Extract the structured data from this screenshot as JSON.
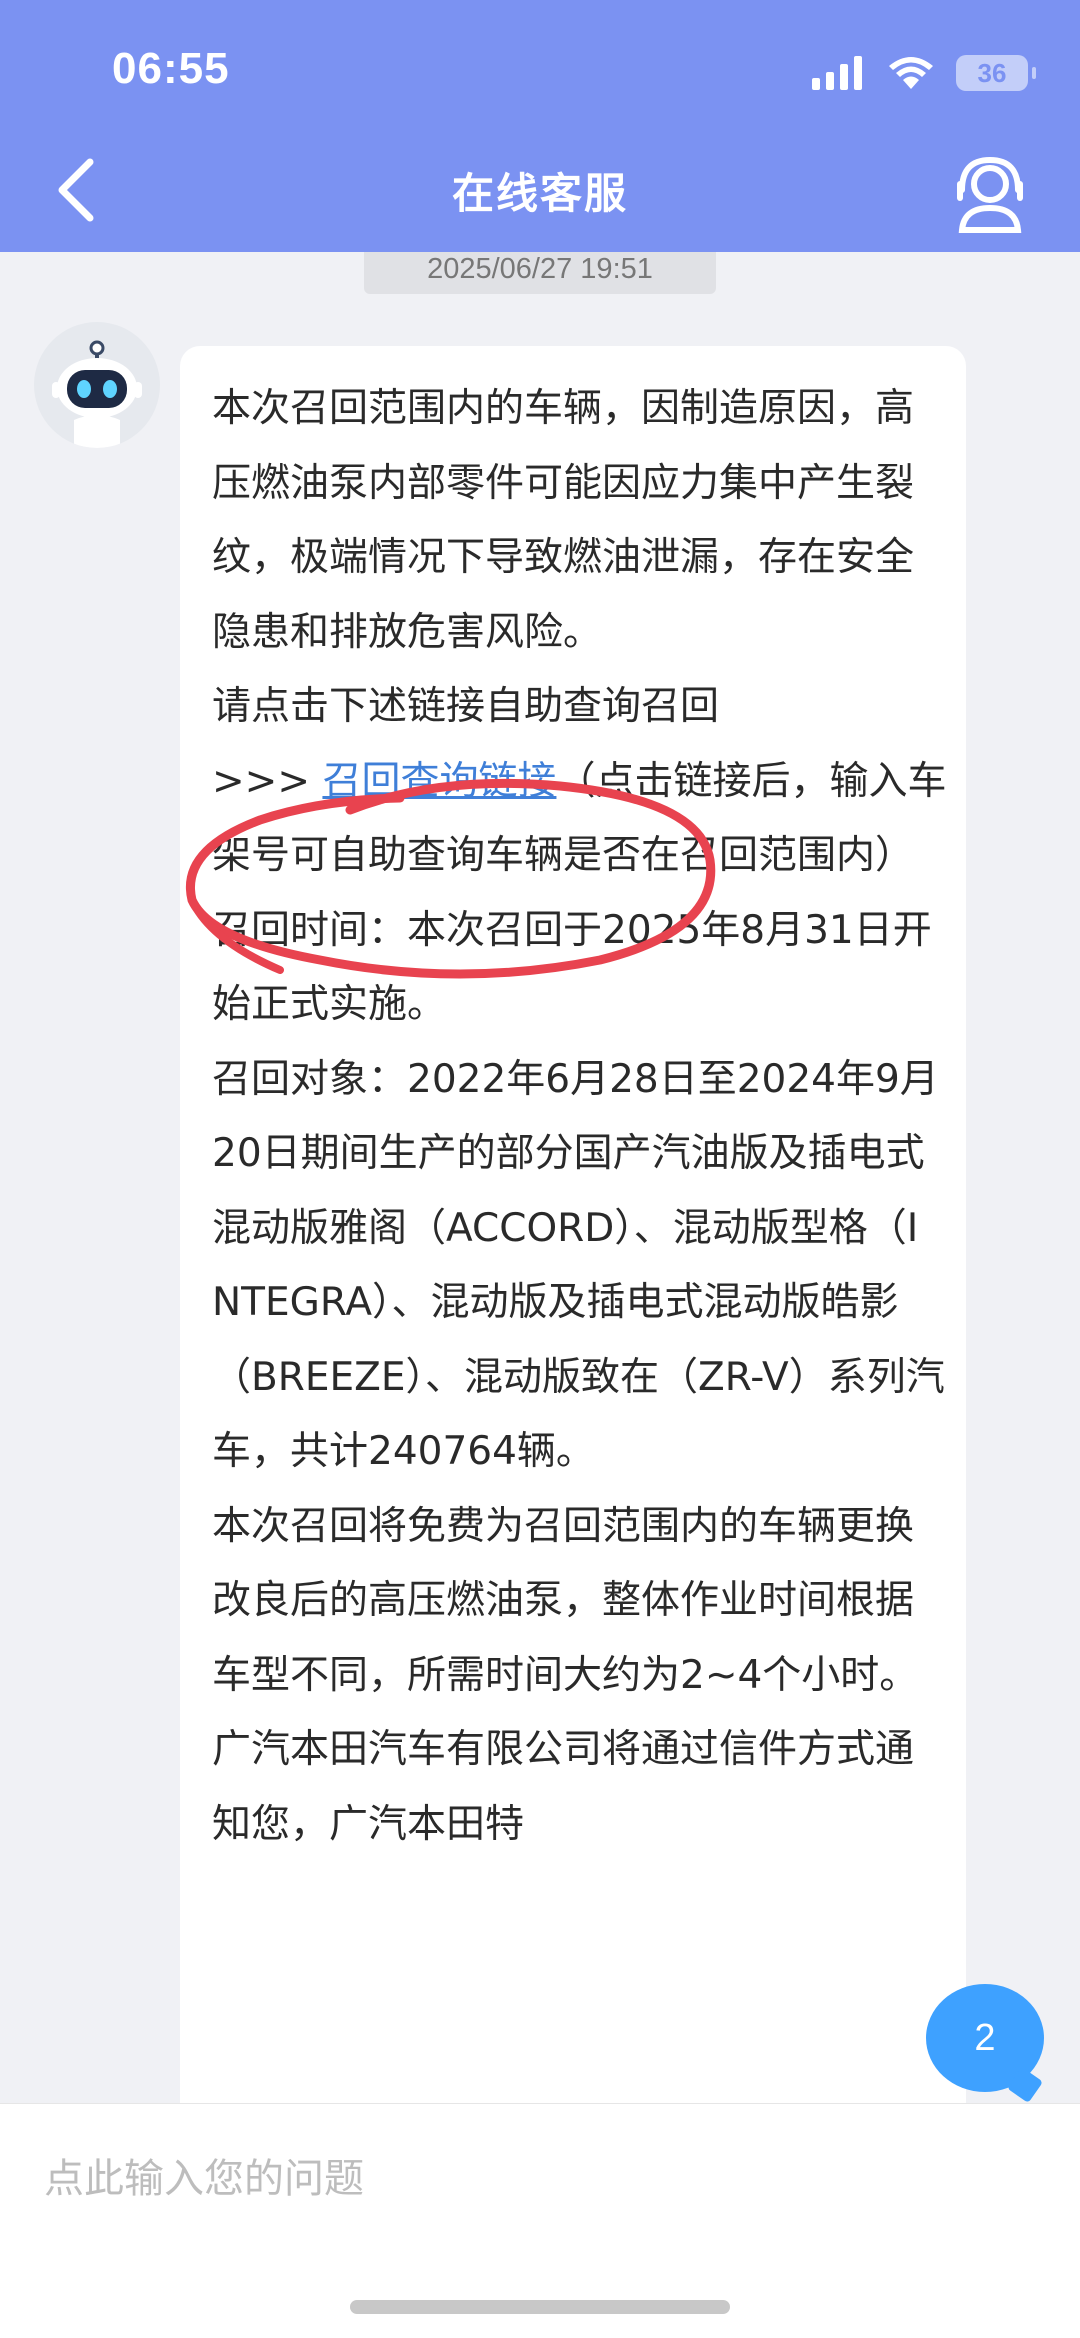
{
  "status_bar": {
    "time": "06:55",
    "battery": "36",
    "icons": [
      "signal-icon",
      "wifi-icon",
      "battery-icon"
    ]
  },
  "header": {
    "title": "在线客服",
    "back_icon": "chevron-left-icon",
    "agent_icon": "customer-service-icon"
  },
  "chat": {
    "timestamp": "2025/06/27 19:51",
    "message": {
      "intro": "本次召回范围内的车辆，因制造原因，高压燃油泵内部零件可能因应力集中产生裂纹，极端情况下导致燃油泄漏，存在安全隐患和排放危害风险。",
      "query_prompt": "请点击下述链接自助查询召回",
      "link_prefix": ">>> ",
      "link_text": "召回查询链接",
      "link_note": "（点击链接后，输入车架号可自助查询车辆是否在召回范围内）",
      "recall_time": "召回时间：本次召回于2025年8月31日开始正式实施。",
      "recall_target": "召回对象：2022年6月28日至2024年9月20日期间生产的部分国产汽油版及插电式混动版雅阁（ACCORD）、混动版型格（INTEGRA）、混动版及插电式混动版皓影（BREEZE）、混动版致在（ZR-V）系列汽车，共计240764辆。",
      "remedy": "本次召回将免费为召回范围内的车辆更换改良后的高压燃油泵，整体作业时间根据车型不同，所需时间大约为2~4个小时。广汽本田汽车有限公司将通过信件方式通知您，广汽本田特"
    },
    "unread_count": "2"
  },
  "input": {
    "placeholder": "点此输入您的问题"
  },
  "colors": {
    "header": "#7b92f2",
    "link": "#3f7fd8",
    "annotation": "#e8434f",
    "badge": "#3ea1ff"
  }
}
